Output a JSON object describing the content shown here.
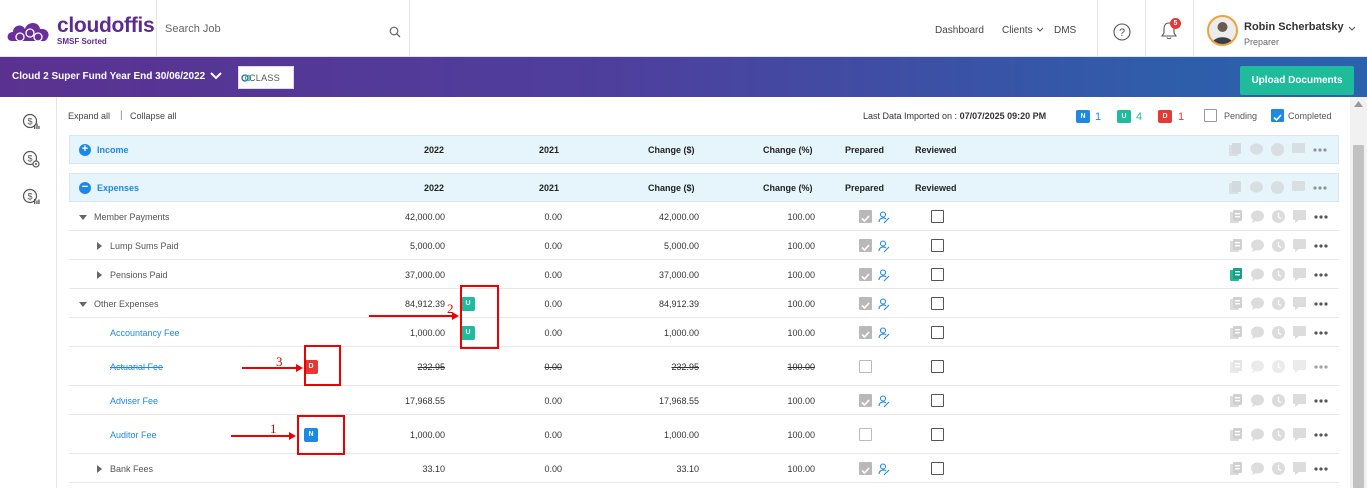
{
  "brand": {
    "name": "cloudoffis",
    "tagline": "SMSF Sorted",
    "color": "#5d2b91"
  },
  "search": {
    "placeholder": "Search Job"
  },
  "nav": {
    "dashboard": "Dashboard",
    "clients": "Clients",
    "dms": "DMS"
  },
  "notifications": {
    "count": "5"
  },
  "user": {
    "name": "Robin Scherbatsky",
    "role": "Preparer"
  },
  "job": {
    "title": "Cloud 2 Super Fund Year End 30/06/2022",
    "software_logo": "CLASS",
    "upload_label": "Upload Documents"
  },
  "toolbar": {
    "expand_all": "Expand all",
    "collapse_all": "Collapse all",
    "imported_label": "Last Data Imported on :",
    "imported_value": "07/07/2025 09:20 PM",
    "legend": [
      {
        "badge": "N",
        "count": "1",
        "color": "#1e88e5"
      },
      {
        "badge": "U",
        "count": "4",
        "color": "#1ebc9a"
      },
      {
        "badge": "D",
        "count": "1",
        "color": "#e53935"
      }
    ],
    "pending_label": "Pending",
    "completed_label": "Completed"
  },
  "columns": {
    "c2022": "2022",
    "c2021": "2021",
    "change_amt": "Change ($)",
    "change_pct": "Change (%)",
    "prepared": "Prepared",
    "reviewed": "Reviewed"
  },
  "sections": {
    "income": "Income",
    "expenses": "Expenses"
  },
  "rows": [
    {
      "label": "Member Payments",
      "v2022": "42,000.00",
      "v2021": "0.00",
      "change": "42,000.00",
      "pct": "100.00"
    },
    {
      "label": "Lump Sums Paid",
      "v2022": "5,000.00",
      "v2021": "0.00",
      "change": "5,000.00",
      "pct": "100.00"
    },
    {
      "label": "Pensions Paid",
      "v2022": "37,000.00",
      "v2021": "0.00",
      "change": "37,000.00",
      "pct": "100.00"
    },
    {
      "label": "Other Expenses",
      "v2022": "84,912.39",
      "v2021": "0.00",
      "change": "84,912.39",
      "pct": "100.00",
      "badge": "U"
    },
    {
      "label": "Accountancy Fee",
      "v2022": "1,000.00",
      "v2021": "0.00",
      "change": "1,000.00",
      "pct": "100.00",
      "badge": "U"
    },
    {
      "label": "Actuarial Fee",
      "v2022": "232.95",
      "v2021": "0.00",
      "change": "232.95",
      "pct": "100.00",
      "badge": "D"
    },
    {
      "label": "Adviser Fee",
      "v2022": "17,968.55",
      "v2021": "0.00",
      "change": "17,968.55",
      "pct": "100.00"
    },
    {
      "label": "Auditor Fee",
      "v2022": "1,000.00",
      "v2021": "0.00",
      "change": "1,000.00",
      "pct": "100.00",
      "badge": "N"
    },
    {
      "label": "Bank Fees",
      "v2022": "33.10",
      "v2021": "0.00",
      "change": "33.10",
      "pct": "100.00"
    }
  ],
  "annotations": [
    "1",
    "2",
    "3"
  ],
  "icons": [
    "search-icon",
    "chevron-down-icon",
    "help-icon",
    "bell-icon",
    "avatar",
    "dollar-report-icon",
    "dollar-settings-icon",
    "dollar-list-icon",
    "document-icon",
    "comment-icon",
    "history-icon",
    "note-icon",
    "more-icon",
    "signed-icon"
  ]
}
